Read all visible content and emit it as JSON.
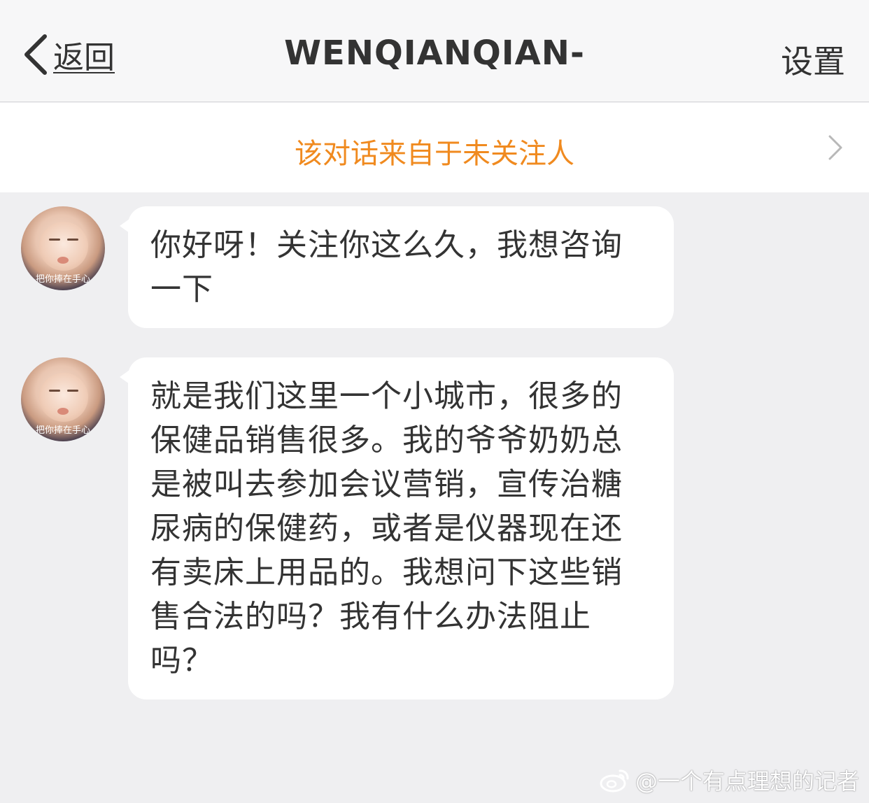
{
  "nav": {
    "back_label": "返回",
    "title": "WENQIANQIAN-",
    "settings_label": "设置"
  },
  "notice": {
    "text": "该对话来自于未关注人"
  },
  "messages": [
    {
      "avatar_caption": "把你捧在手心",
      "text": "你好呀！关注你这么久，我想咨询一下"
    },
    {
      "avatar_caption": "把你捧在手心",
      "text": "就是我们这里一个小城市，很多的保健品销售很多。我的爷爷奶奶总是被叫去参加会议营销，宣传治糖尿病的保健药，或者是仪器现在还有卖床上用品的。我想问下这些销售合法的吗？我有什么办法阻止吗？"
    }
  ],
  "watermark": {
    "icon": "weibo-logo",
    "text": "@一个有点理想的记者"
  },
  "colors": {
    "notice_text": "#f08a1f",
    "background": "#efeff1",
    "nav_background": "#f7f7f8",
    "bubble": "#ffffff"
  }
}
